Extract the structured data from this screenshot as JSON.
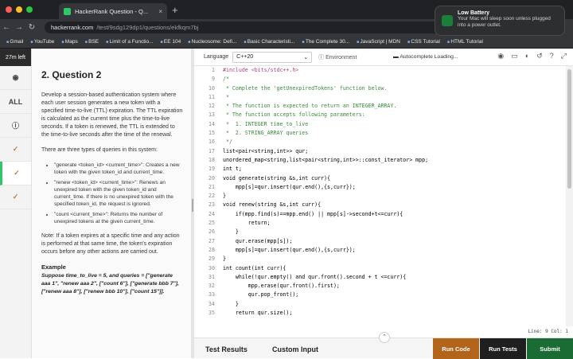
{
  "browser": {
    "tab_title": "HackerRank Question - Q...",
    "tab_close": "×",
    "new_tab": "+",
    "url_host": "hackerrank.com",
    "url_path": "/test/9sdg129dp1/questions/ekfkqm7bj",
    "bookmarks": [
      "Gmail",
      "YouTube",
      "Maps",
      "BSE",
      "Limit of a Functio...",
      "EE 104",
      "Nucleosome: Defi...",
      "Basic Characteristi...",
      "The Complete 30...",
      "JavaScript | MDN",
      "CSS Tutorial",
      "HTML Tutorial"
    ]
  },
  "notification": {
    "title": "Low Battery",
    "body": "Your Mac will sleep soon unless plugged into a power outlet."
  },
  "rail": {
    "timer": "27m left",
    "all": "ALL",
    "check": "✓"
  },
  "problem": {
    "title": "2. Question 2",
    "p1": "Develop a session-based authentication system where each user session generates a new token with a specified time-to-live (TTL) expiration. The TTL expiration is calculated as the current time plus the time-to-live seconds. If a token is renewed, the TTL is extended to the time-to-live seconds after the time of the renewal.",
    "p2": "There are three types of queries in this system:",
    "q1": "\"generate <token_id> <current_time>\": Creates a new token with the given token_id and current_time.",
    "q2": "\"renew <token_id> <current_time>\": Renews an unexpired token with the given token_id and current_time. If there is no unexpired token with the specified token_id, the request is ignored.",
    "q3": "\"count <current_time>\": Returns the number of unexpired tokens at the given current_time.",
    "p3": "Note: If a token expires at a specific time and any action is performed at that same time, the token's expiration occurs before any other actions are carried out.",
    "example_title": "Example",
    "example_text": "Suppose time_to_live = 5, and queries = [\"generate aaa 1\", \"renew aaa 2\", [\"count 6\"], [\"generate bbb 7\"], [\"renew aaa 8\"], [\"renew bbb 10\"], [\"count 15\"]]."
  },
  "editor": {
    "language_label": "Language",
    "language": "C++20",
    "environment": "Environment",
    "autocomplete": "Autocomplete Loading...",
    "lines": [
      {
        "n": "1",
        "t": "#include <bits/stdc++.h>",
        "k": "pp"
      },
      {
        "n": "9",
        "t": "/*",
        "k": "cm"
      },
      {
        "n": "10",
        "t": " * Complete the 'getUnexpiredTokens' function below.",
        "k": "cm"
      },
      {
        "n": "11",
        "t": " *",
        "k": "cm"
      },
      {
        "n": "12",
        "t": " * The function is expected to return an INTEGER_ARRAY.",
        "k": "cm"
      },
      {
        "n": "13",
        "t": " * The function accepts following parameters:",
        "k": "cm"
      },
      {
        "n": "14",
        "t": " *  1. INTEGER time_to_live",
        "k": "cm"
      },
      {
        "n": "15",
        "t": " *  2. STRING_ARRAY queries",
        "k": "cm"
      },
      {
        "n": "16",
        "t": " */",
        "k": "cm"
      },
      {
        "n": "17",
        "t": "list<pair<string,int>> qur;",
        "k": ""
      },
      {
        "n": "18",
        "t": "unordered_map<string,list<pair<string,int>>::const_iterator> mpp;",
        "k": ""
      },
      {
        "n": "19",
        "t": "int t;",
        "k": ""
      },
      {
        "n": "20",
        "t": "void generate(string &s,int curr){",
        "k": ""
      },
      {
        "n": "21",
        "t": "    mpp[s]=qur.insert(qur.end(),{s,curr});",
        "k": ""
      },
      {
        "n": "22",
        "t": "}",
        "k": ""
      },
      {
        "n": "23",
        "t": "void renew(string &s,int curr){",
        "k": ""
      },
      {
        "n": "24",
        "t": "    if(mpp.find(s)==mpp.end() || mpp[s]->second+t<=curr){",
        "k": ""
      },
      {
        "n": "25",
        "t": "        return;",
        "k": ""
      },
      {
        "n": "26",
        "t": "    }",
        "k": ""
      },
      {
        "n": "27",
        "t": "    qur.erase(mpp[s]);",
        "k": ""
      },
      {
        "n": "28",
        "t": "    mpp[s]=qur.insert(qur.end(),{s,curr});",
        "k": ""
      },
      {
        "n": "29",
        "t": "}",
        "k": ""
      },
      {
        "n": "30",
        "t": "int count(int curr){",
        "k": ""
      },
      {
        "n": "31",
        "t": "    while(!qur.empty() and qur.front().second + t <=curr){",
        "k": ""
      },
      {
        "n": "32",
        "t": "        mpp.erase(qur.front().first);",
        "k": ""
      },
      {
        "n": "33",
        "t": "        qur.pop_front();",
        "k": ""
      },
      {
        "n": "34",
        "t": "    }",
        "k": ""
      },
      {
        "n": "35",
        "t": "    return qur.size();",
        "k": ""
      }
    ],
    "cursor_position": "Line: 9 Col: 1"
  },
  "bottom": {
    "test_results": "Test Results",
    "custom_input": "Custom Input",
    "run_code": "Run Code",
    "run_tests": "Run Tests",
    "submit": "Submit"
  },
  "colors": {
    "run_code": "#b3641b",
    "run_tests": "#1f1f1f",
    "submit": "#1a6b34"
  }
}
